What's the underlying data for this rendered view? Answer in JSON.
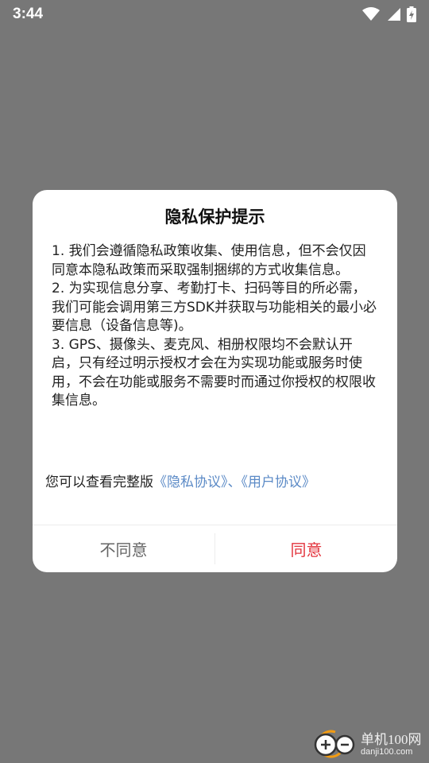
{
  "status_bar": {
    "time": "3:44",
    "icons": [
      "wifi-icon",
      "signal-icon",
      "battery-charging-icon"
    ]
  },
  "dialog": {
    "title": "隐私保护提示",
    "paragraphs": [
      "1. 我们会遵循隐私政策收集、使用信息，但不会仅因同意本隐私政策而采取强制捆绑的方式收集信息。",
      "2. 为实现信息分享、考勤打卡、扫码等目的所必需，我们可能会调用第三方SDK并获取与功能相关的最小必要信息（设备信息等)。",
      "3. GPS、摄像头、麦克风、相册权限均不会默认开启，只有经过明示授权才会在为实现功能或服务时使用，不会在功能或服务不需要时而通过你授权的权限收集信息。"
    ],
    "links_prefix": "您可以查看完整版",
    "privacy_link": "《隐私协议》",
    "separator": "、",
    "user_link": "《用户协议》",
    "disagree_label": "不同意",
    "agree_label": "同意"
  },
  "watermark": {
    "name": "单机100网",
    "url": "danji100.com"
  },
  "colors": {
    "overlay": "#777777",
    "link": "#5b8ac6",
    "agree": "#e3333c",
    "disagree": "#666666"
  }
}
